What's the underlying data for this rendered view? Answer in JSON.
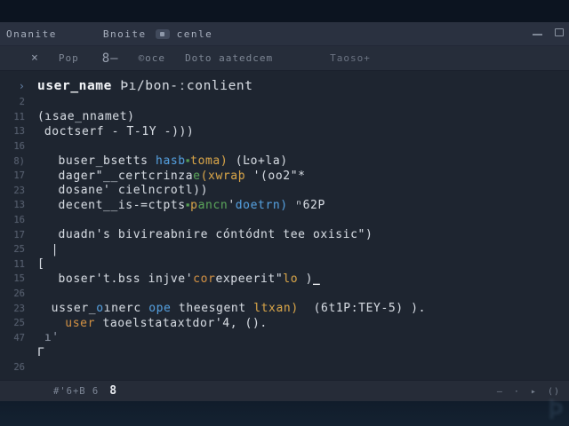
{
  "colors": {
    "outer_bg": "#0c1420",
    "titlebar_bg": "#2a3140",
    "toolbar_bg": "#262d3a",
    "editor_bg": "#1e2530",
    "statusbar_bg": "#262c38",
    "text_main": "#d3d8df",
    "text_bold": "#f1f3f6",
    "syntax_blue": "#4f9bdb",
    "syntax_yellow": "#d4a042",
    "syntax_green": "#55a054",
    "syntax_orange": "#cd8b3d",
    "line_numbers": "#525b6b"
  },
  "titlebar": {
    "tab1": "Onanite",
    "tab2": "Bnoite",
    "tab3": "cenle"
  },
  "toolbar": {
    "close": "×",
    "item1": "Pop",
    "item2": "8—",
    "item3": "©oce",
    "item4": "Doto aatedcem",
    "item5": "Taoso+"
  },
  "editor": {
    "lines": [
      {
        "num": "›",
        "chev": true,
        "size": "lg",
        "indent": 0,
        "segments": [
          {
            "t": "user_name",
            "c": "bold"
          },
          {
            "t": " Þı/bon-ːconlient",
            "c": "fg"
          }
        ]
      },
      {
        "num": "2",
        "indent": 0,
        "segments": []
      },
      {
        "num": "11",
        "indent": 0,
        "segments": [
          {
            "t": "(ɿsae_nnamet)",
            "c": "fg"
          }
        ]
      },
      {
        "num": "13",
        "indent": 1,
        "segments": [
          {
            "t": "doctserf - T-1Y -)))",
            "c": "fg"
          }
        ]
      },
      {
        "num": "16",
        "indent": 0,
        "segments": []
      },
      {
        "num": "8)",
        "indent": 3,
        "segments": [
          {
            "t": "buser_bsetts ",
            "c": "fg"
          },
          {
            "t": "hasb",
            "c": "blue"
          },
          {
            "t": "▪",
            "c": "dot"
          },
          {
            "t": "toma)",
            "c": "yellow"
          },
          {
            "t": " (Ŀo+la)",
            "c": "fg"
          }
        ]
      },
      {
        "num": "17",
        "indent": 3,
        "segments": [
          {
            "t": "dager\"__certcrinza",
            "c": "fg"
          },
          {
            "t": "e",
            "c": "green"
          },
          {
            "t": "(xwraþ",
            "c": "yellow"
          },
          {
            "t": " '(oo2\"*",
            "c": "fg"
          }
        ]
      },
      {
        "num": "23",
        "indent": 3,
        "segments": [
          {
            "t": "dosane' cielncrotl))",
            "c": "fg"
          }
        ]
      },
      {
        "num": "13",
        "indent": 3,
        "segments": [
          {
            "t": "decent__is-=ctpts",
            "c": "fg"
          },
          {
            "t": "▪",
            "c": "dot"
          },
          {
            "t": "p",
            "c": "yellow"
          },
          {
            "t": "ancn",
            "c": "green"
          },
          {
            "t": "'",
            "c": "fg"
          },
          {
            "t": "doetrn)",
            "c": "blue"
          },
          {
            "t": " ⁿ62P",
            "c": "fg"
          }
        ]
      },
      {
        "num": "16",
        "indent": 0,
        "segments": []
      },
      {
        "num": "17",
        "indent": 3,
        "segments": [
          {
            "t": "duadn's bivireabnire cóntódnt tee oxisic\")",
            "c": "fg"
          }
        ]
      },
      {
        "num": "25",
        "indent": 2,
        "segments": [
          {
            "t": "|",
            "c": "fg"
          }
        ]
      },
      {
        "num": "11",
        "indent": 0,
        "segments": [
          {
            "t": "[",
            "c": "fg"
          }
        ]
      },
      {
        "num": "15",
        "indent": 3,
        "segments": [
          {
            "t": "boser't.bss injve'",
            "c": "fg"
          },
          {
            "t": "cor",
            "c": "orange"
          },
          {
            "t": "expeerit\"",
            "c": "fg"
          },
          {
            "t": "lo",
            "c": "yellow"
          },
          {
            "t": " )",
            "c": "fg"
          },
          {
            "t": "_",
            "c": "bold"
          }
        ]
      },
      {
        "num": "26",
        "indent": 0,
        "segments": []
      },
      {
        "num": "23",
        "indent": 2,
        "segments": [
          {
            "t": "usser_",
            "c": "fg"
          },
          {
            "t": "o",
            "c": "blue"
          },
          {
            "t": "ınerc ",
            "c": "fg"
          },
          {
            "t": "ope",
            "c": "blue"
          },
          {
            "t": " theesgent ",
            "c": "fg"
          },
          {
            "t": "ltxan)",
            "c": "yellow"
          },
          {
            "t": "  (6t1P:TEY-5) ).",
            "c": "fg"
          }
        ]
      },
      {
        "num": "25",
        "indent": 4,
        "segments": [
          {
            "t": "user",
            "c": "orange"
          },
          {
            "t": " taoelstataxtdor'4, ().",
            "c": "fg"
          }
        ]
      },
      {
        "num": "47",
        "indent": 1,
        "segments": [
          {
            "t": "ı'",
            "c": "dim"
          }
        ]
      },
      {
        "num": "",
        "indent": 0,
        "segments": [
          {
            "t": "Γ",
            "c": "fg"
          }
        ]
      },
      {
        "num": "26",
        "indent": 0,
        "segments": []
      }
    ]
  },
  "statusbar": {
    "left_dim": "#'6+B 6",
    "left_bold": "8",
    "icon_min": "—",
    "icon_dot": "·",
    "icon_play": "▸",
    "icon_braces": "()"
  },
  "watermark": "Þ"
}
